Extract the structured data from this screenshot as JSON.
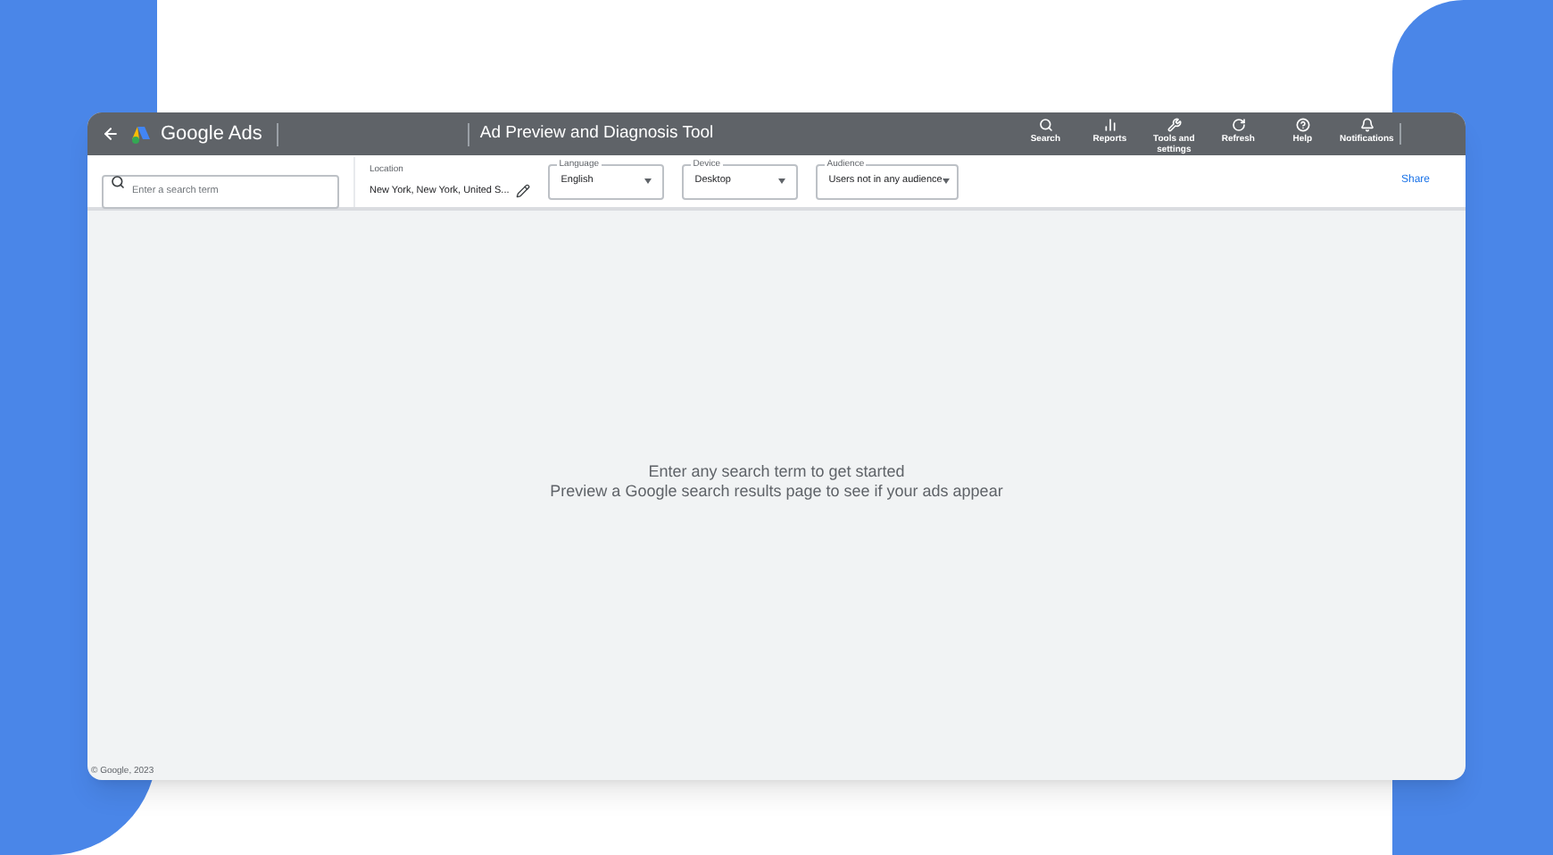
{
  "header": {
    "app_name": "Google Ads",
    "tool_title": "Ad Preview and Diagnosis Tool",
    "actions": [
      {
        "kind": "search",
        "label": "Search"
      },
      {
        "kind": "reports",
        "label": "Reports"
      },
      {
        "kind": "tools",
        "label": "Tools and settings"
      },
      {
        "kind": "refresh",
        "label": "Refresh"
      },
      {
        "kind": "help",
        "label": "Help"
      },
      {
        "kind": "notifications",
        "label": "Notifications"
      }
    ]
  },
  "toolbar": {
    "search": {
      "placeholder": "Enter a search term"
    },
    "location": {
      "label": "Location",
      "value": "New York, New York, United S..."
    },
    "dropdowns": [
      {
        "label": "Language",
        "value": "English"
      },
      {
        "label": "Device",
        "value": "Desktop"
      },
      {
        "label": "Audience",
        "value": "Users not in any audience"
      }
    ],
    "share": "Share"
  },
  "empty_state": {
    "title": "Enter any search term to get started",
    "subtitle": "Preview a Google search results page to see if your ads appear"
  },
  "footer": "© Google, 2023"
}
